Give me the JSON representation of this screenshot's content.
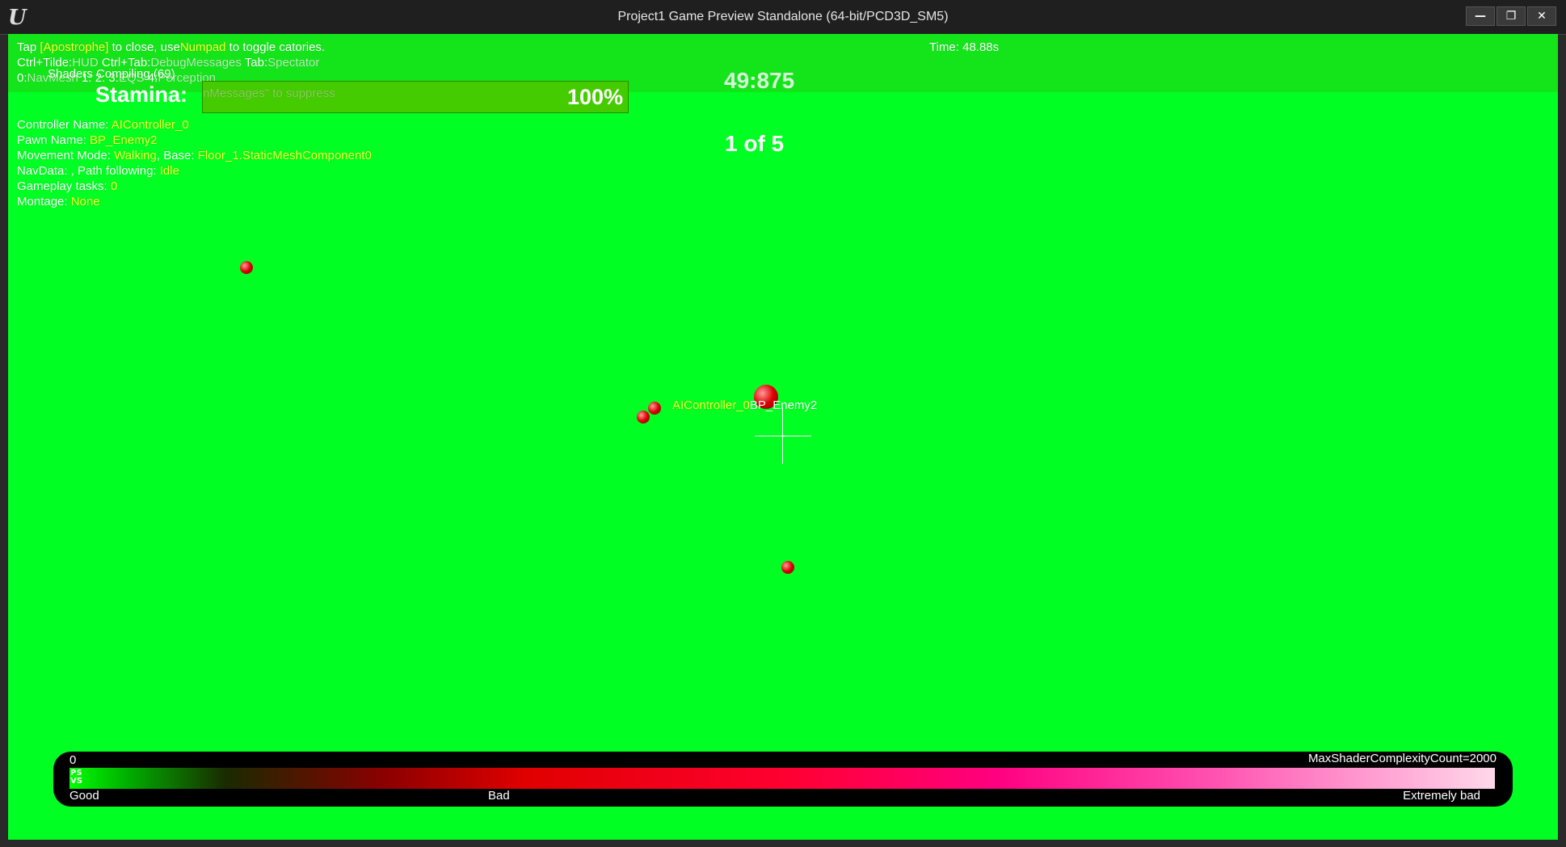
{
  "window": {
    "title": "Project1 Game Preview Standalone (64-bit/PCD3D_SM5)",
    "logo": "U",
    "buttons": {
      "minimize": "—",
      "maximize": "❐",
      "close": "✕"
    }
  },
  "debug": {
    "line1": {
      "a": "Tap ",
      "b": "[Apostrophe]",
      "c": " to close, use",
      "d": "Numpad",
      "e": " to toggle catories."
    },
    "time": "Time: 48.88s",
    "line2": {
      "a": "Ctrl+Tilde:",
      "b": "HUD",
      "c": "  Ctrl+Tab:",
      "d": "DebugMessages",
      "e": "  Tab:",
      "f": "Spectator"
    },
    "line3": {
      "a": "0:",
      "b": "NavMesh",
      "c": "  1:",
      "d": "  2:",
      "e": "            3:",
      "f": "EQS",
      "g": "  4:",
      "h": "Perception"
    },
    "shaders": "Shaders Compiling (69)",
    "suppress": "nMessages\" to suppress",
    "controller": {
      "label": "Controller Name: ",
      "value": "AIController_0"
    },
    "pawn": {
      "label": "Pawn Name: ",
      "value": "BP_Enemy2"
    },
    "movement": {
      "label": "Movement Mode: ",
      "value": "Walking",
      "base_label": ", Base: ",
      "base_value": "Floor_1.StaticMeshComponent0"
    },
    "navdata": {
      "label": "NavData: , Path following: ",
      "value": "Idle"
    },
    "tasks": {
      "label": "Gameplay tasks: ",
      "value": "0"
    },
    "montage": {
      "label": "Montage: ",
      "value": "None"
    }
  },
  "hud": {
    "stamina_label": "Stamina:",
    "stamina_value": "100%",
    "stamina_fraction": 1.0,
    "timer": "49:875",
    "wave": "1 of 5"
  },
  "actor_label": {
    "controller": "AIController_0",
    "pawn": "BP_Enemy2"
  },
  "legend": {
    "min": "0",
    "max": "MaxShaderComplexityCount=2000",
    "ps": "PS",
    "vs": "VS",
    "good": "Good",
    "bad": "Bad",
    "extremely_bad": "Extremely bad"
  }
}
